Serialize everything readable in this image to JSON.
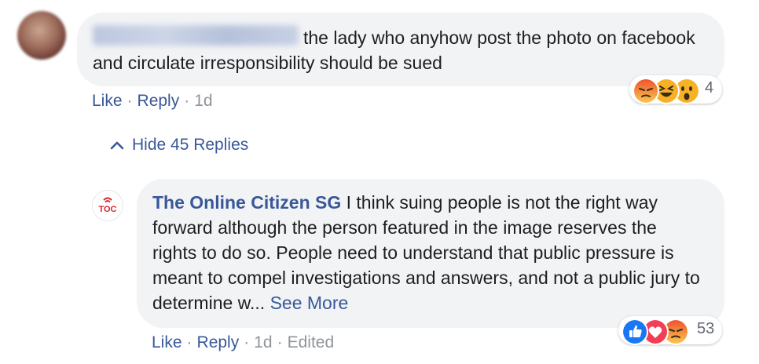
{
  "comment": {
    "text": "the lady who anyhow post the photo on facebook and circulate irresponsibility should be sued",
    "actions": {
      "like": "Like",
      "reply": "Reply",
      "time": "1d"
    },
    "reactions": {
      "icons": [
        "angry-icon",
        "laugh-icon",
        "wow-icon"
      ],
      "count": "4"
    }
  },
  "replies_toggle": {
    "label": "Hide 45 Replies"
  },
  "reply": {
    "author": "The Online Citizen SG",
    "avatar_text": "TOC",
    "text": "I think suing people is not the right way forward although the person featured in the image reserves the rights to do so. People need to understand that public pressure is meant to compel investigations and answers, and not a public jury to determine w...",
    "see_more": "See More",
    "actions": {
      "like": "Like",
      "reply": "Reply",
      "time": "1d",
      "edited": "Edited"
    },
    "reactions": {
      "icons": [
        "like-icon",
        "love-icon",
        "angry-icon"
      ],
      "count": "53"
    }
  },
  "colors": {
    "link": "#385898",
    "bubble": "#f2f3f5",
    "meta": "#90949c",
    "like": "#1877f2",
    "love": "#f33e58",
    "angry": "#e9710f",
    "yellow": "#f7b125"
  }
}
